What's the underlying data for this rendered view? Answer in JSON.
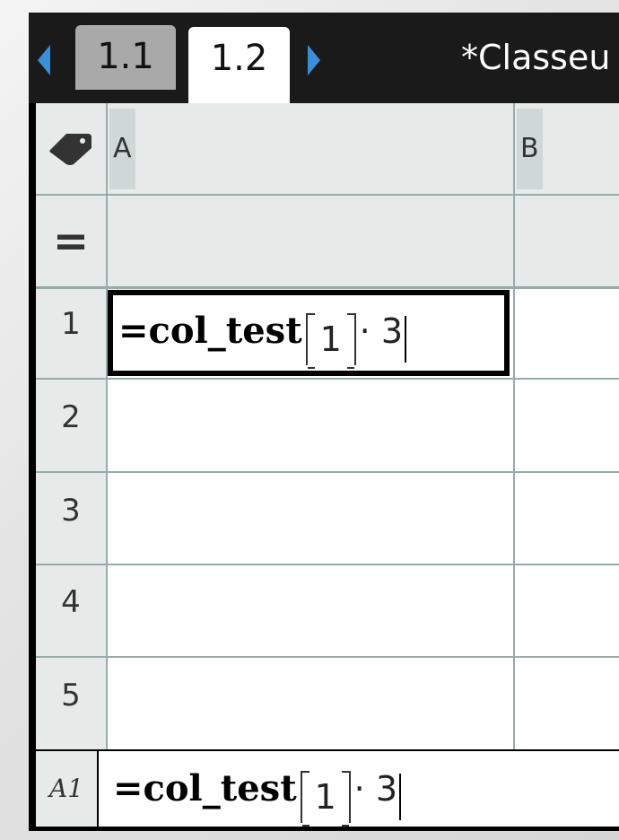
{
  "tabs": [
    {
      "label": "1.1",
      "active": false
    },
    {
      "label": "1.2",
      "active": true
    }
  ],
  "document_title": "*Classeu",
  "columns": [
    "A",
    "B"
  ],
  "rows": [
    "1",
    "2",
    "3",
    "4",
    "5"
  ],
  "formula_row_symbol": "=",
  "cell_a1": {
    "prefix": "=col_test",
    "index": "1",
    "suffix": "· 3"
  },
  "entry_line": {
    "cell_ref": "A1",
    "prefix": "=col_test",
    "index": "1",
    "suffix": "· 3"
  },
  "colors": {
    "tab_arrow": "#3a8fd8",
    "header_bg": "#e6ebea",
    "grid_line": "#99aaaa"
  }
}
